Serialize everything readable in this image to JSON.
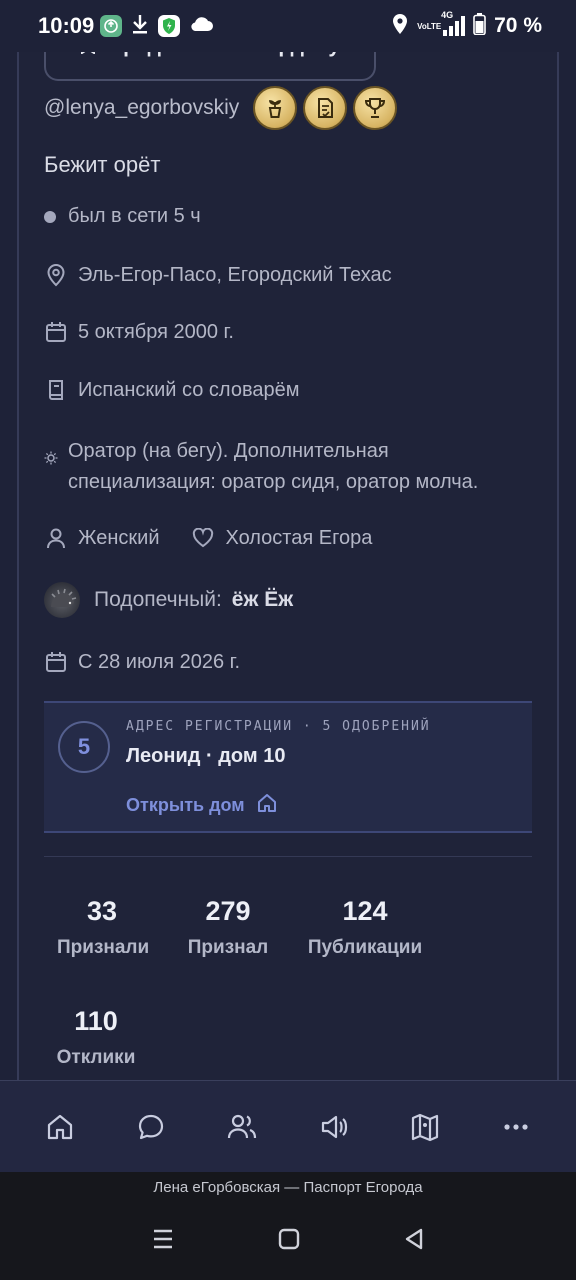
{
  "status_bar": {
    "time": "10:09",
    "network": "4G",
    "volte": "VoLTE",
    "battery": "70 %"
  },
  "profile": {
    "top_button_label": "Представить к ордену",
    "handle": "@lenya_egorbovskiy",
    "badges": [
      "plant-badge-icon",
      "document-badge-icon",
      "trophy-badge-icon"
    ],
    "bio": "Бежит орёт",
    "online_status": "был в сети 5 ч",
    "location": "Эль-Егор-Пасо, Егородский Техас",
    "birthday": "5 октября 2000 г.",
    "language": "Испанский со словарём",
    "specialization": "Оратор (на бегу). Дополнительная специализация: оратор сидя, оратор молча.",
    "gender": "Женский",
    "relationship": "Холостая Егора",
    "ward_label": "Подопечный:",
    "ward_name": "ёж Ёж",
    "since": "С 28 июля 2026 г."
  },
  "registration": {
    "number": "5",
    "label": "АДРЕС РЕГИСТРАЦИИ · 5 ОДОБРЕНИЙ",
    "title": "Леонид · дом 10",
    "link": "Открыть дом"
  },
  "stats": [
    {
      "value": "33",
      "label": "Признали"
    },
    {
      "value": "279",
      "label": "Признал"
    },
    {
      "value": "124",
      "label": "Публикации"
    },
    {
      "value": "110",
      "label": "Отклики"
    }
  ],
  "bottom_nav": [
    "home-icon",
    "chat-icon",
    "people-icon",
    "megaphone-icon",
    "map-icon",
    "more-icon"
  ],
  "footer_text": "Лена еГорбовская — Паспорт Егорода",
  "colors": {
    "background": "#1e2238",
    "accent": "#7e8fdb",
    "badge_gold": "#d7b463"
  }
}
